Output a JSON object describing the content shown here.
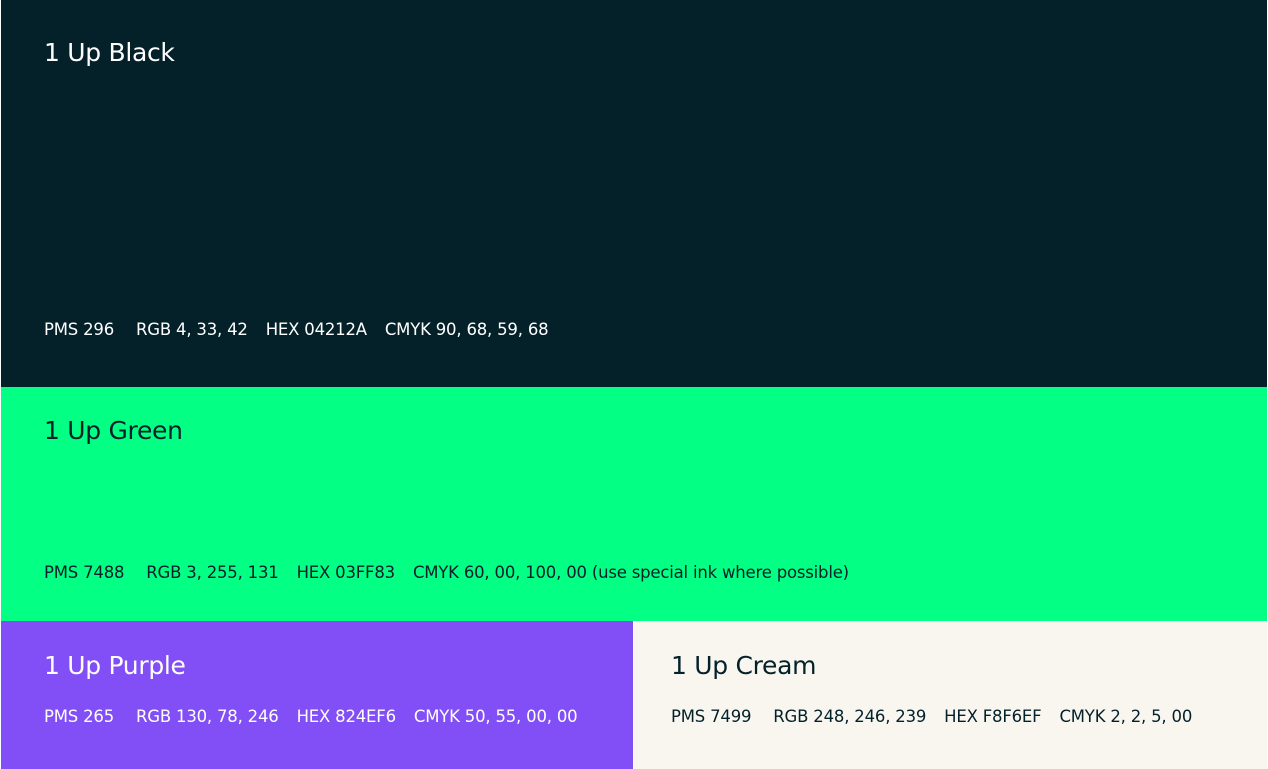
{
  "swatches": {
    "black": {
      "name": "1 Up Black",
      "pms": "PMS 296",
      "rgb": "RGB 4, 33, 42",
      "hex": "HEX 04212A",
      "cmyk": "CMYK 90, 68, 59, 68",
      "color": "#04212A",
      "text_color": "#FFFFFF"
    },
    "green": {
      "name": "1 Up Green",
      "pms": "PMS 7488",
      "rgb": "RGB 3, 255, 131",
      "hex": "HEX 03FF83",
      "cmyk": "CMYK 60, 00, 100, 00 (use special ink where possible)",
      "color": "#03FF83",
      "text_color": "#04212A"
    },
    "purple": {
      "name": "1 Up Purple",
      "pms": "PMS 265",
      "rgb": "RGB 130, 78, 246",
      "hex": "HEX 824EF6",
      "cmyk": "CMYK 50, 55, 00, 00",
      "color": "#824EF6",
      "text_color": "#FFFFFF"
    },
    "cream": {
      "name": "1 Up Cream",
      "pms": "PMS 7499",
      "rgb": "RGB 248, 246, 239",
      "hex": "HEX F8F6EF",
      "cmyk": "CMYK 2, 2, 5, 00",
      "color": "#F8F6EF",
      "text_color": "#04212A"
    }
  }
}
